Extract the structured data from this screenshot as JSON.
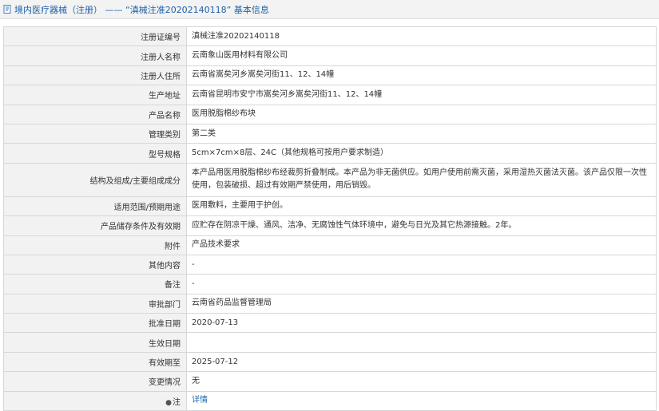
{
  "header": {
    "title": "境内医疗器械（注册） —— “滇械注准20202140118” 基本信息"
  },
  "rows": [
    {
      "label": "注册证编号",
      "value": "滇械注准20202140118"
    },
    {
      "label": "注册人名称",
      "value": "云南象山医用材料有限公司"
    },
    {
      "label": "注册人住所",
      "value": "云南省嵩矣河乡嵩矣河街11、12、14幢"
    },
    {
      "label": "生产地址",
      "value": "云南省昆明市安宁市嵩矣河乡嵩矣河街11、12、14幢"
    },
    {
      "label": "产品名称",
      "value": "医用脱脂棉纱布块"
    },
    {
      "label": "管理类别",
      "value": "第二类"
    },
    {
      "label": "型号规格",
      "value": "5cm×7cm×8层、24C（其他规格可按用户要求制造）"
    },
    {
      "label": "结构及组成/主要组成成分",
      "value": "本产品用医用脱脂棉纱布经裁剪折叠制成。本产品为非无菌供应。如用户使用前需灭菌，采用湿热灭菌法灭菌。该产品仅限一次性使用，包装破损、超过有效期严禁使用，用后销毁。"
    },
    {
      "label": "适用范围/预期用途",
      "value": "医用敷料，主要用于护创。"
    },
    {
      "label": "产品储存条件及有效期",
      "value": "应贮存在阴凉干燥、通风、洁净、无腐蚀性气体环境中，避免与日光及其它热源接触。2年。"
    },
    {
      "label": "附件",
      "value": "产品技术要求"
    },
    {
      "label": "其他内容",
      "value": "-"
    },
    {
      "label": "备注",
      "value": "-"
    },
    {
      "label": "审批部门",
      "value": "云南省药品监督管理局"
    },
    {
      "label": "批准日期",
      "value": "2020-07-13"
    },
    {
      "label": "生效日期",
      "value": ""
    },
    {
      "label": "有效期至",
      "value": "2025-07-12"
    },
    {
      "label": "变更情况",
      "value": "无"
    },
    {
      "label": "注",
      "value": "详情"
    }
  ]
}
